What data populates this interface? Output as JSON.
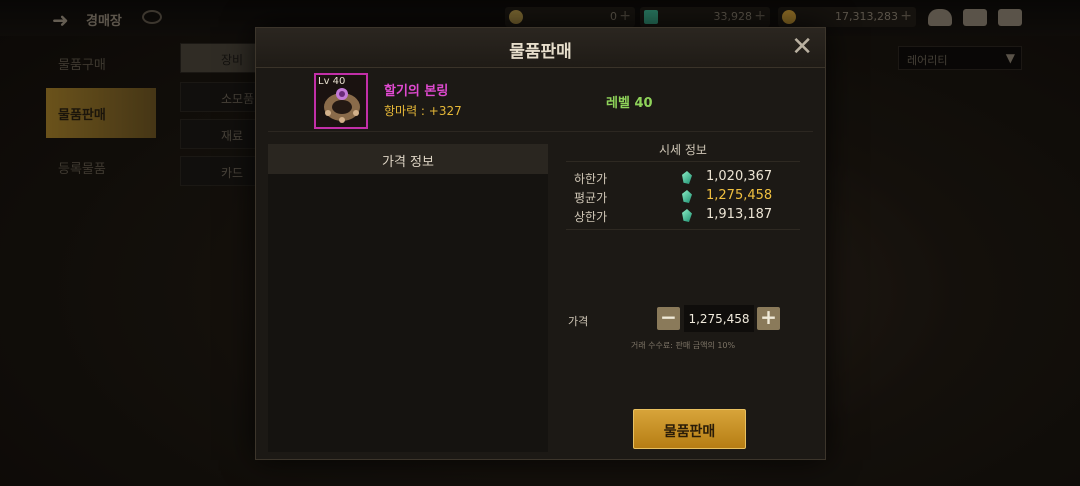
{
  "topbar": {
    "title": "경매장",
    "currency": [
      {
        "value": "0",
        "color": "#b89a4a"
      },
      {
        "value": "33,928",
        "color": "#3fb894"
      },
      {
        "value": "17,313,283",
        "color": "#d8a53a"
      }
    ]
  },
  "sidebar": {
    "items": [
      {
        "label": "물품구매"
      },
      {
        "label": "물품판매"
      },
      {
        "label": "등록물품"
      }
    ]
  },
  "subtabs": [
    {
      "label": "장비"
    },
    {
      "label": "소모품"
    },
    {
      "label": "재료"
    },
    {
      "label": "카드"
    }
  ],
  "sort": {
    "selected": "레어리티"
  },
  "modal": {
    "title": "물품판매",
    "item": {
      "level_badge": "Lv 40",
      "name": "할기의 본링",
      "stat": "항마력 : +327",
      "level": "레벨 40",
      "rarity_color": "#c22fa8"
    },
    "price_info_title": "가격 정보",
    "market": {
      "title": "시세 정보",
      "rows": [
        {
          "label": "하한가",
          "value": "1,020,367"
        },
        {
          "label": "평균가",
          "value": "1,275,458"
        },
        {
          "label": "상한가",
          "value": "1,913,187"
        }
      ]
    },
    "price": {
      "label": "가격",
      "value": "1,275,458",
      "minus": "−",
      "plus": "+"
    },
    "fee_note": "거래 수수료: 판매 금액의 10%",
    "sell_button": "물품판매",
    "close": "✕"
  }
}
